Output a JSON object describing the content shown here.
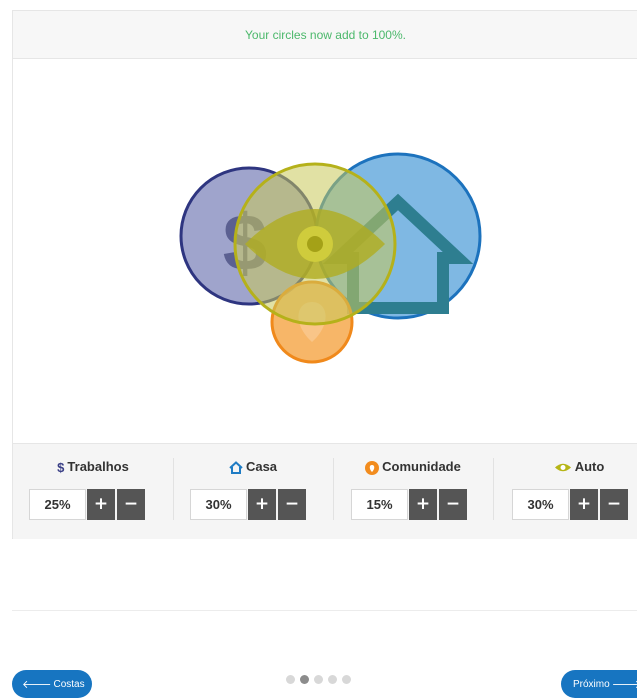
{
  "banner": {
    "message": "Your circles now add to 100%."
  },
  "categories": [
    {
      "icon": "dollar-icon",
      "symbol": "$",
      "label": "Trabalhos",
      "value": "25%",
      "color": "#3a3f86"
    },
    {
      "icon": "house-icon",
      "label": "Casa",
      "value": "30%",
      "color": "#1f7cc4"
    },
    {
      "icon": "heart-icon",
      "label": "Comunidade",
      "value": "15%",
      "color": "#f28c1e"
    },
    {
      "icon": "eye-icon",
      "label": "Auto",
      "value": "30%",
      "color": "#b6b516"
    }
  ],
  "stepper": {
    "plus": "+",
    "minus": "−"
  },
  "nav": {
    "back_label": "Costas",
    "next_label": "Próximo",
    "arrow_back": "🡐",
    "arrow_next": "🡒",
    "total_steps": 5,
    "current_step": 2
  }
}
